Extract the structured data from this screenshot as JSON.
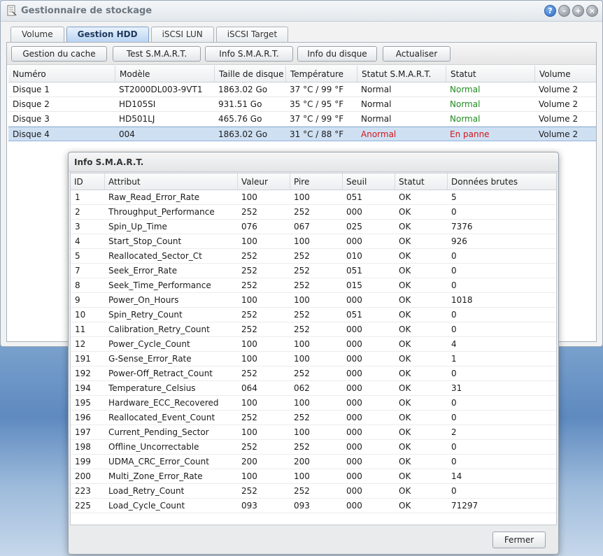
{
  "window": {
    "title": "Gestionnaire de stockage",
    "icon": "storage-manager-icon",
    "buttons": [
      {
        "name": "help",
        "glyph": "?"
      },
      {
        "name": "minimize",
        "glyph": "–"
      },
      {
        "name": "maximize",
        "glyph": "+"
      },
      {
        "name": "close",
        "glyph": "×"
      }
    ]
  },
  "tabs": [
    {
      "label": "Volume",
      "active": false
    },
    {
      "label": "Gestion HDD",
      "active": true
    },
    {
      "label": "iSCSI LUN",
      "active": false
    },
    {
      "label": "iSCSI Target",
      "active": false
    }
  ],
  "toolbar": [
    "Gestion du cache",
    "Test S.M.A.R.T.",
    "Info S.M.A.R.T.",
    "Info du disque",
    "Actualiser"
  ],
  "hdd_table": {
    "columns": [
      "Numéro",
      "Modèle",
      "Taille de disque",
      "Température",
      "Statut S.M.A.R.T.",
      "Statut",
      "Volume"
    ],
    "rows": [
      [
        "Disque 1",
        "ST2000DL003-9VT1",
        "1863.02 Go",
        "37 °C / 99 °F",
        "Normal",
        "Normal",
        "Volume 2"
      ],
      [
        "Disque 2",
        "HD105SI",
        "931.51 Go",
        "35 °C / 95 °F",
        "Normal",
        "Normal",
        "Volume 2"
      ],
      [
        "Disque 3",
        "HD501LJ",
        "465.76 Go",
        "37 °C / 99 °F",
        "Normal",
        "Normal",
        "Volume 2"
      ],
      [
        "Disque 4",
        "004",
        "1863.02 Go",
        "31 °C / 88 °F",
        "Anormal",
        "En panne",
        "Volume 2"
      ]
    ],
    "selected_row": 3,
    "colors": {
      "ok": "#1f8a1f",
      "bad": "#d01818",
      "selected": "#cfe0f3"
    }
  },
  "smart_dialog": {
    "title": "Info S.M.A.R.T.",
    "columns": [
      "ID",
      "Attribut",
      "Valeur",
      "Pire",
      "Seuil",
      "Statut",
      "Données brutes"
    ],
    "rows": [
      [
        "1",
        "Raw_Read_Error_Rate",
        "100",
        "100",
        "051",
        "OK",
        "5"
      ],
      [
        "2",
        "Throughput_Performance",
        "252",
        "252",
        "000",
        "OK",
        "0"
      ],
      [
        "3",
        "Spin_Up_Time",
        "076",
        "067",
        "025",
        "OK",
        "7376"
      ],
      [
        "4",
        "Start_Stop_Count",
        "100",
        "100",
        "000",
        "OK",
        "926"
      ],
      [
        "5",
        "Reallocated_Sector_Ct",
        "252",
        "252",
        "010",
        "OK",
        "0"
      ],
      [
        "7",
        "Seek_Error_Rate",
        "252",
        "252",
        "051",
        "OK",
        "0"
      ],
      [
        "8",
        "Seek_Time_Performance",
        "252",
        "252",
        "015",
        "OK",
        "0"
      ],
      [
        "9",
        "Power_On_Hours",
        "100",
        "100",
        "000",
        "OK",
        "1018"
      ],
      [
        "10",
        "Spin_Retry_Count",
        "252",
        "252",
        "051",
        "OK",
        "0"
      ],
      [
        "11",
        "Calibration_Retry_Count",
        "252",
        "252",
        "000",
        "OK",
        "0"
      ],
      [
        "12",
        "Power_Cycle_Count",
        "100",
        "100",
        "000",
        "OK",
        "4"
      ],
      [
        "191",
        "G-Sense_Error_Rate",
        "100",
        "100",
        "000",
        "OK",
        "1"
      ],
      [
        "192",
        "Power-Off_Retract_Count",
        "252",
        "252",
        "000",
        "OK",
        "0"
      ],
      [
        "194",
        "Temperature_Celsius",
        "064",
        "062",
        "000",
        "OK",
        "31"
      ],
      [
        "195",
        "Hardware_ECC_Recovered",
        "100",
        "100",
        "000",
        "OK",
        "0"
      ],
      [
        "196",
        "Reallocated_Event_Count",
        "252",
        "252",
        "000",
        "OK",
        "0"
      ],
      [
        "197",
        "Current_Pending_Sector",
        "100",
        "100",
        "000",
        "OK",
        "2"
      ],
      [
        "198",
        "Offline_Uncorrectable",
        "252",
        "252",
        "000",
        "OK",
        "0"
      ],
      [
        "199",
        "UDMA_CRC_Error_Count",
        "200",
        "200",
        "000",
        "OK",
        "0"
      ],
      [
        "200",
        "Multi_Zone_Error_Rate",
        "100",
        "100",
        "000",
        "OK",
        "14"
      ],
      [
        "223",
        "Load_Retry_Count",
        "252",
        "252",
        "000",
        "OK",
        "0"
      ],
      [
        "225",
        "Load_Cycle_Count",
        "093",
        "093",
        "000",
        "OK",
        "71297"
      ]
    ],
    "close_label": "Fermer"
  }
}
